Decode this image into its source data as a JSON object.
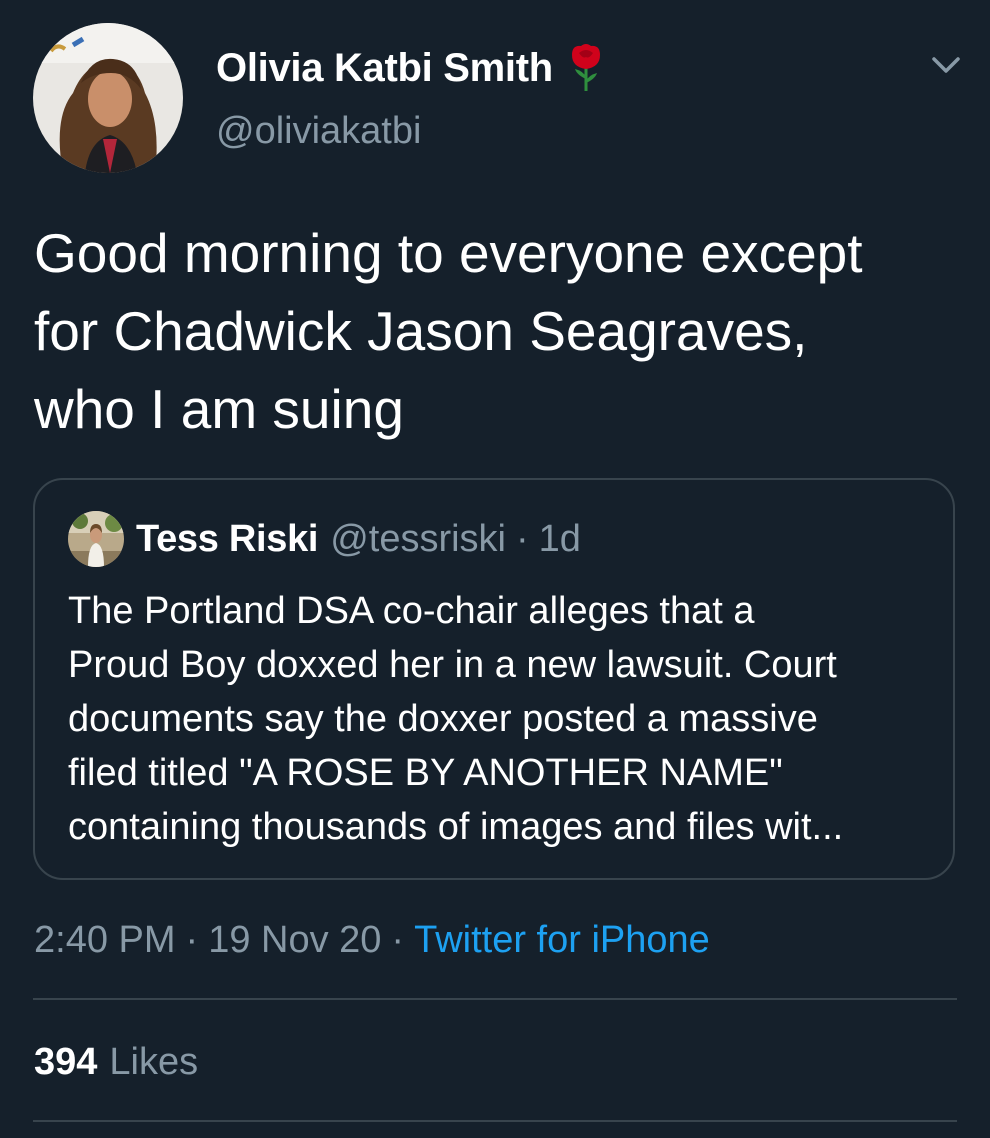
{
  "tweet": {
    "author": {
      "display_name": "Olivia Katbi Smith",
      "name_emoji": "rose-icon",
      "handle": "@oliviakatbi"
    },
    "text": "Good morning to everyone except\nfor Chadwick Jason Seagraves,\nwho I am suing",
    "quoted": {
      "author_name": "Tess Riski",
      "author_handle": "@tessriski",
      "separator": "·",
      "age": "1d",
      "text": "The Portland DSA co-chair alleges that a\nProud Boy doxxed her in a new lawsuit. Court\ndocuments say the doxxer posted a massive\nfiled titled \"A ROSE BY ANOTHER NAME\"\ncontaining thousands of images and files wit..."
    },
    "meta": {
      "time": "2:40 PM",
      "separator": "·",
      "date": "19 Nov 20",
      "source": "Twitter for iPhone"
    },
    "stats": {
      "likes_count": "394",
      "likes_label": "Likes"
    }
  },
  "colors": {
    "background": "#15202b",
    "text": "#ffffff",
    "secondary": "#8899a6",
    "link": "#1da1f2",
    "border": "#38444d",
    "rose": "#d0021b"
  }
}
